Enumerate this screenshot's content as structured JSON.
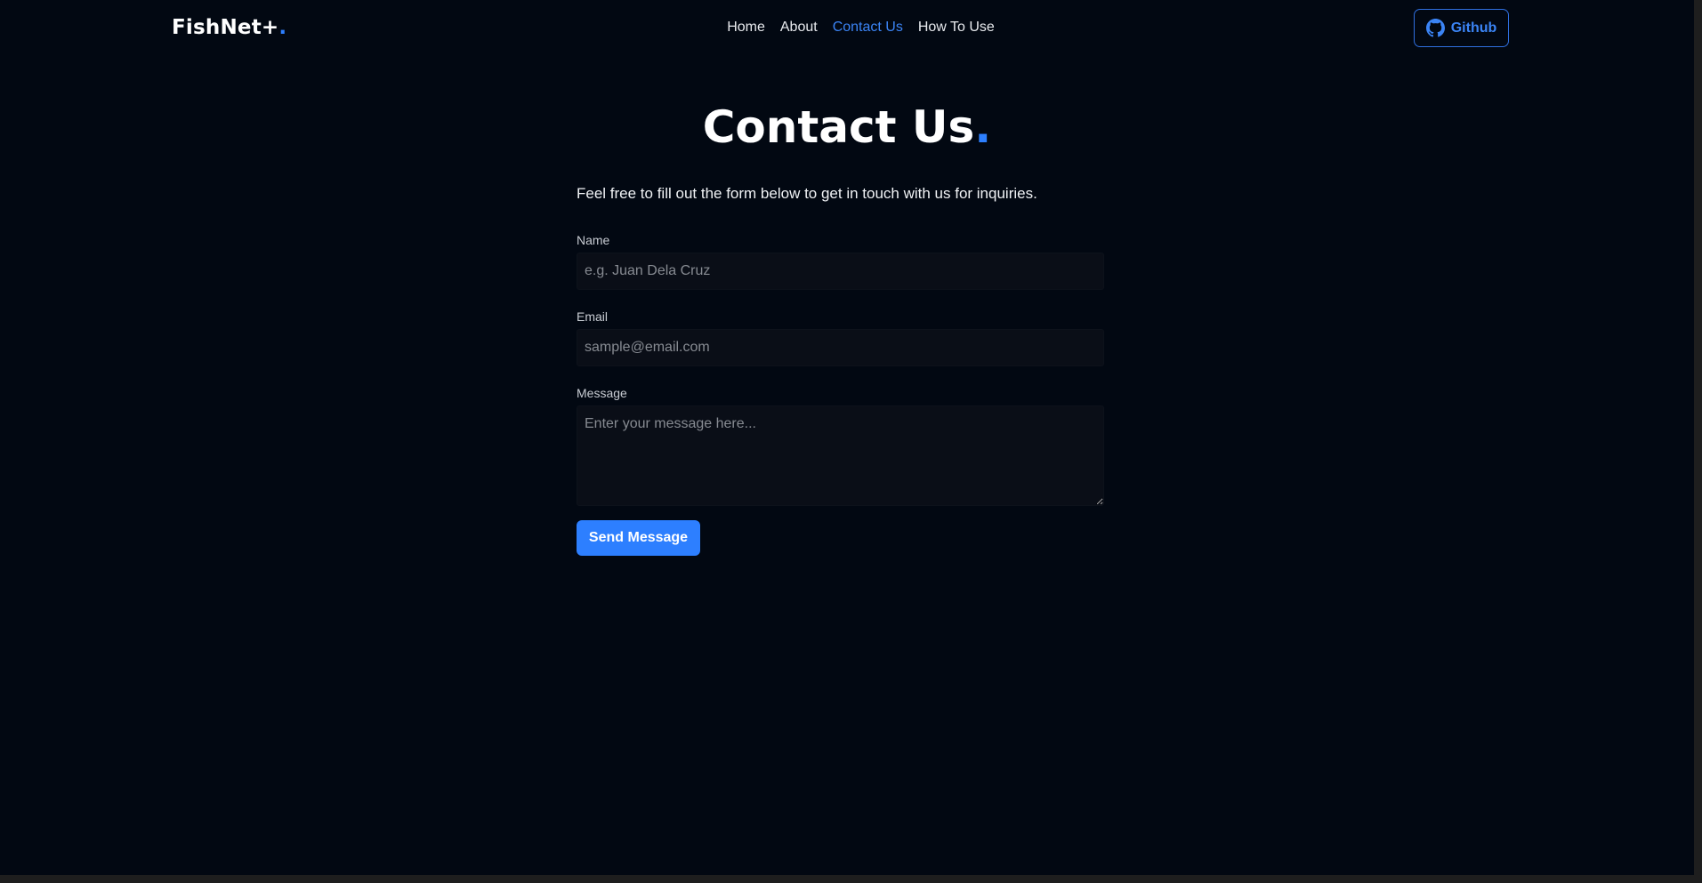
{
  "brand": {
    "name": "FishNet+",
    "dot": ".",
    "accent_color": "#2d7fff"
  },
  "nav": {
    "links": [
      {
        "label": "Home",
        "active": false
      },
      {
        "label": "About",
        "active": false
      },
      {
        "label": "Contact Us",
        "active": true
      },
      {
        "label": "How To Use",
        "active": false
      }
    ],
    "github_label": "Github",
    "github_icon": "github-icon"
  },
  "page": {
    "title": "Contact Us",
    "title_dot": ".",
    "intro": "Feel free to fill out the form below to get in touch with us for inquiries."
  },
  "form": {
    "name_label": "Name",
    "name_placeholder": "e.g. Juan Dela Cruz",
    "name_value": "",
    "email_label": "Email",
    "email_placeholder": "sample@email.com",
    "email_value": "",
    "message_label": "Message",
    "message_placeholder": "Enter your message here...",
    "message_value": "",
    "submit_label": "Send Message"
  },
  "colors": {
    "background": "#020812",
    "accent": "#2d7fff",
    "active_link": "#3b84f5"
  }
}
